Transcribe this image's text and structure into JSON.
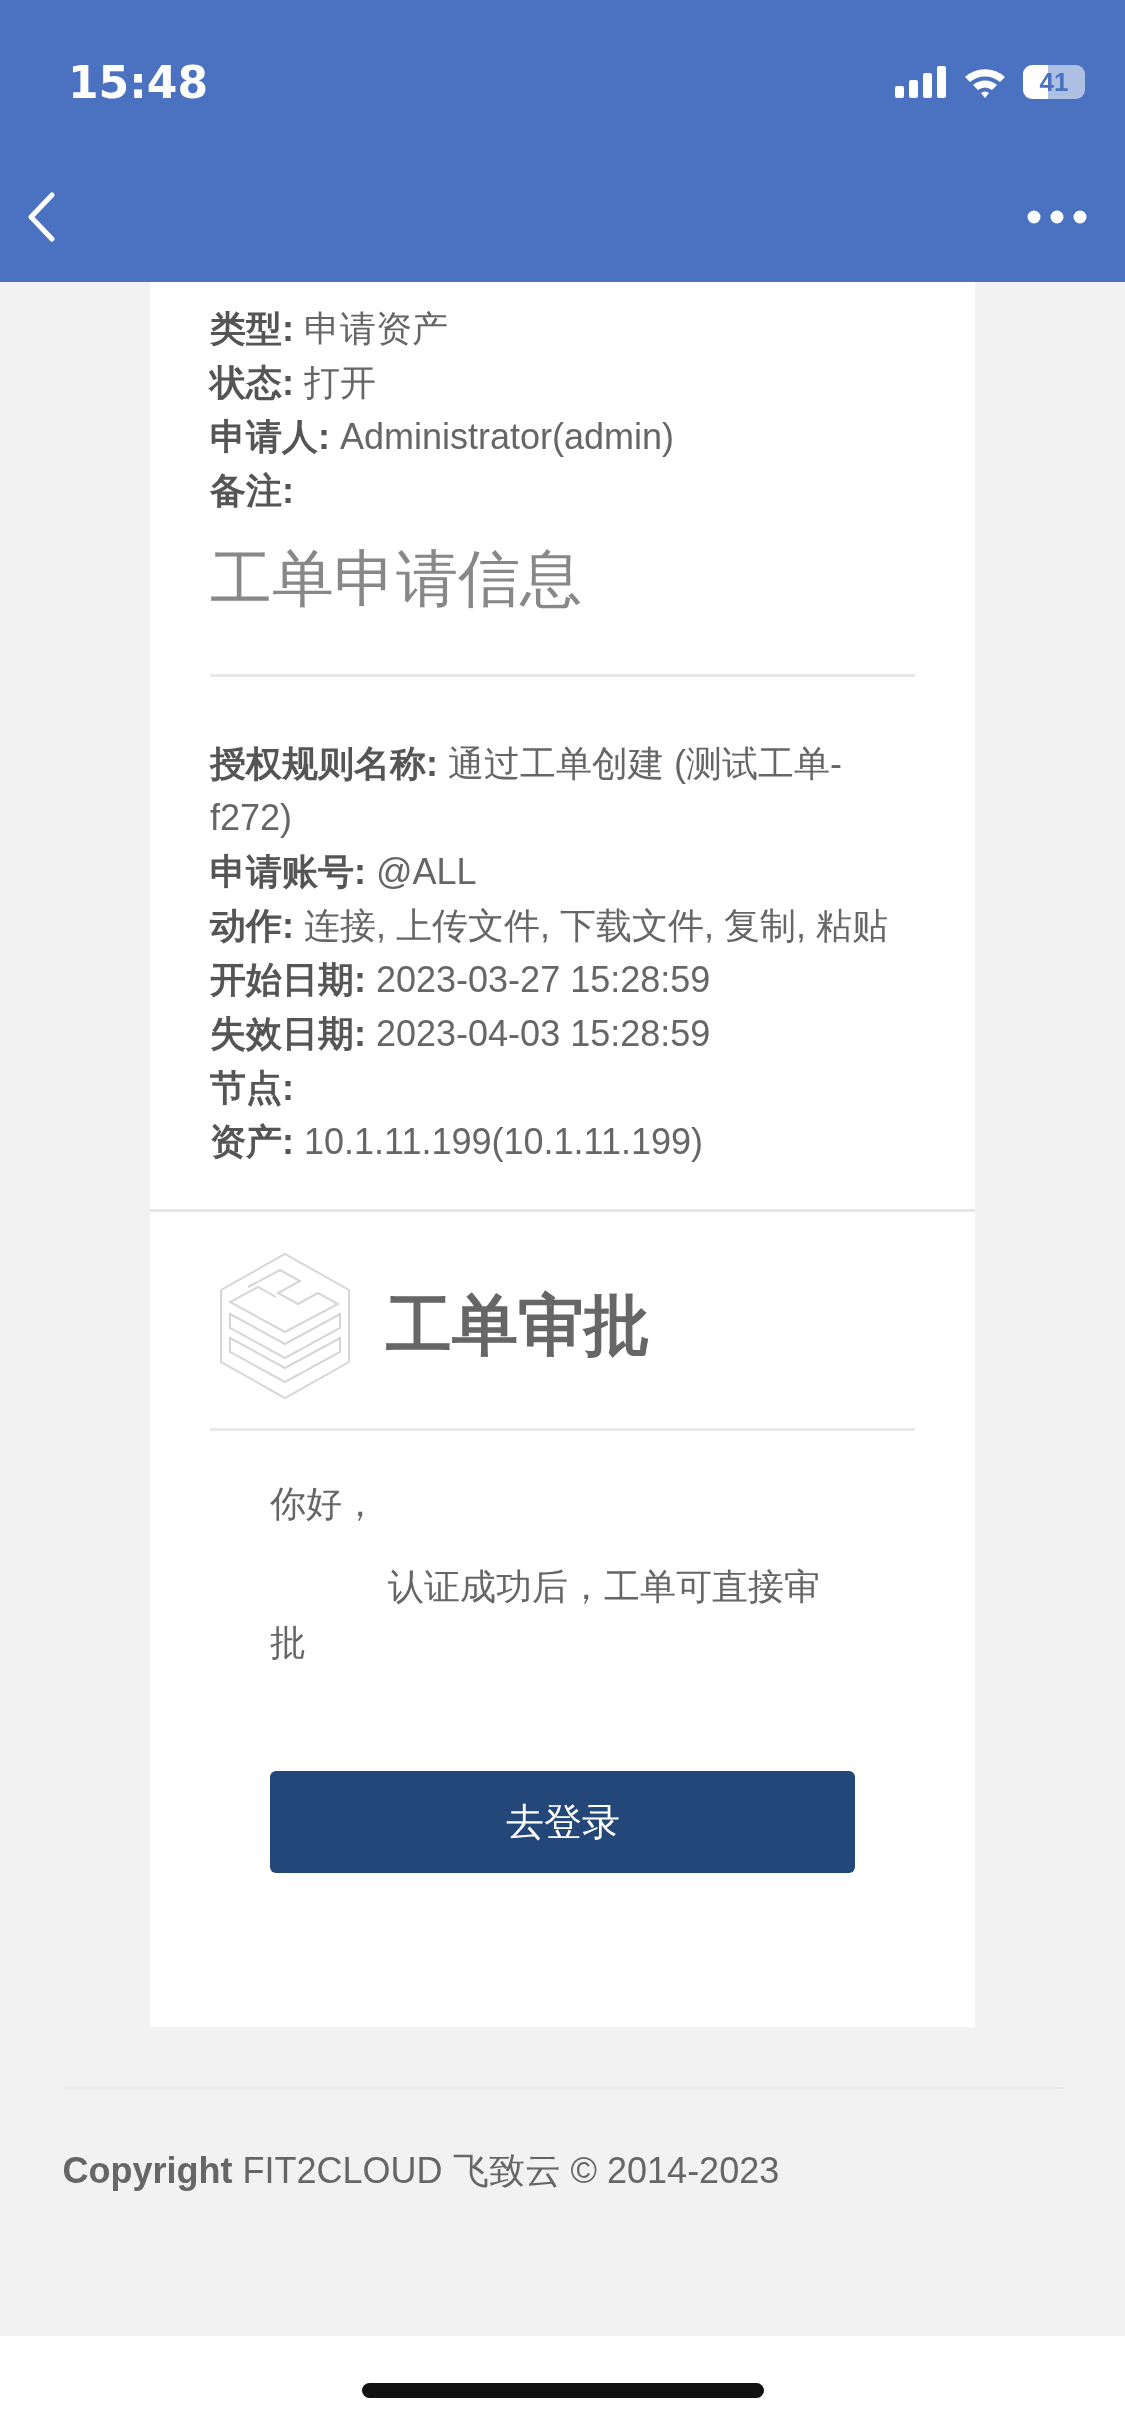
{
  "status_bar": {
    "time": "15:48",
    "battery": "41"
  },
  "request_fields": [
    "**类型:** 申请资产",
    "**状态:** 打开",
    "**申请人:** Administrator(admin)",
    "**备注:**"
  ],
  "section_heading": "工单申请信息",
  "rule_fields": [
    "**授权规则名称:** 通过工单创建 (测试工单-f272)",
    "**申请账号:** @ALL",
    "**动作:** 连接, 上传文件, 下载文件, 复制, 粘贴",
    "**开始日期:** 2023-03-27 15:28:59",
    "**失效日期:** 2023-04-03 15:28:59",
    "**节点:**",
    "**资产:** 10.1.11.199(10.1.11.199)"
  ],
  "approval": {
    "title": "工单审批",
    "greeting": "你好，",
    "message": "认证成功后，工单可直接审批",
    "button": "去登录"
  },
  "footer": {
    "copyright": "**Copyright** FIT2CLOUD 飞致云 © 2014-2023"
  }
}
